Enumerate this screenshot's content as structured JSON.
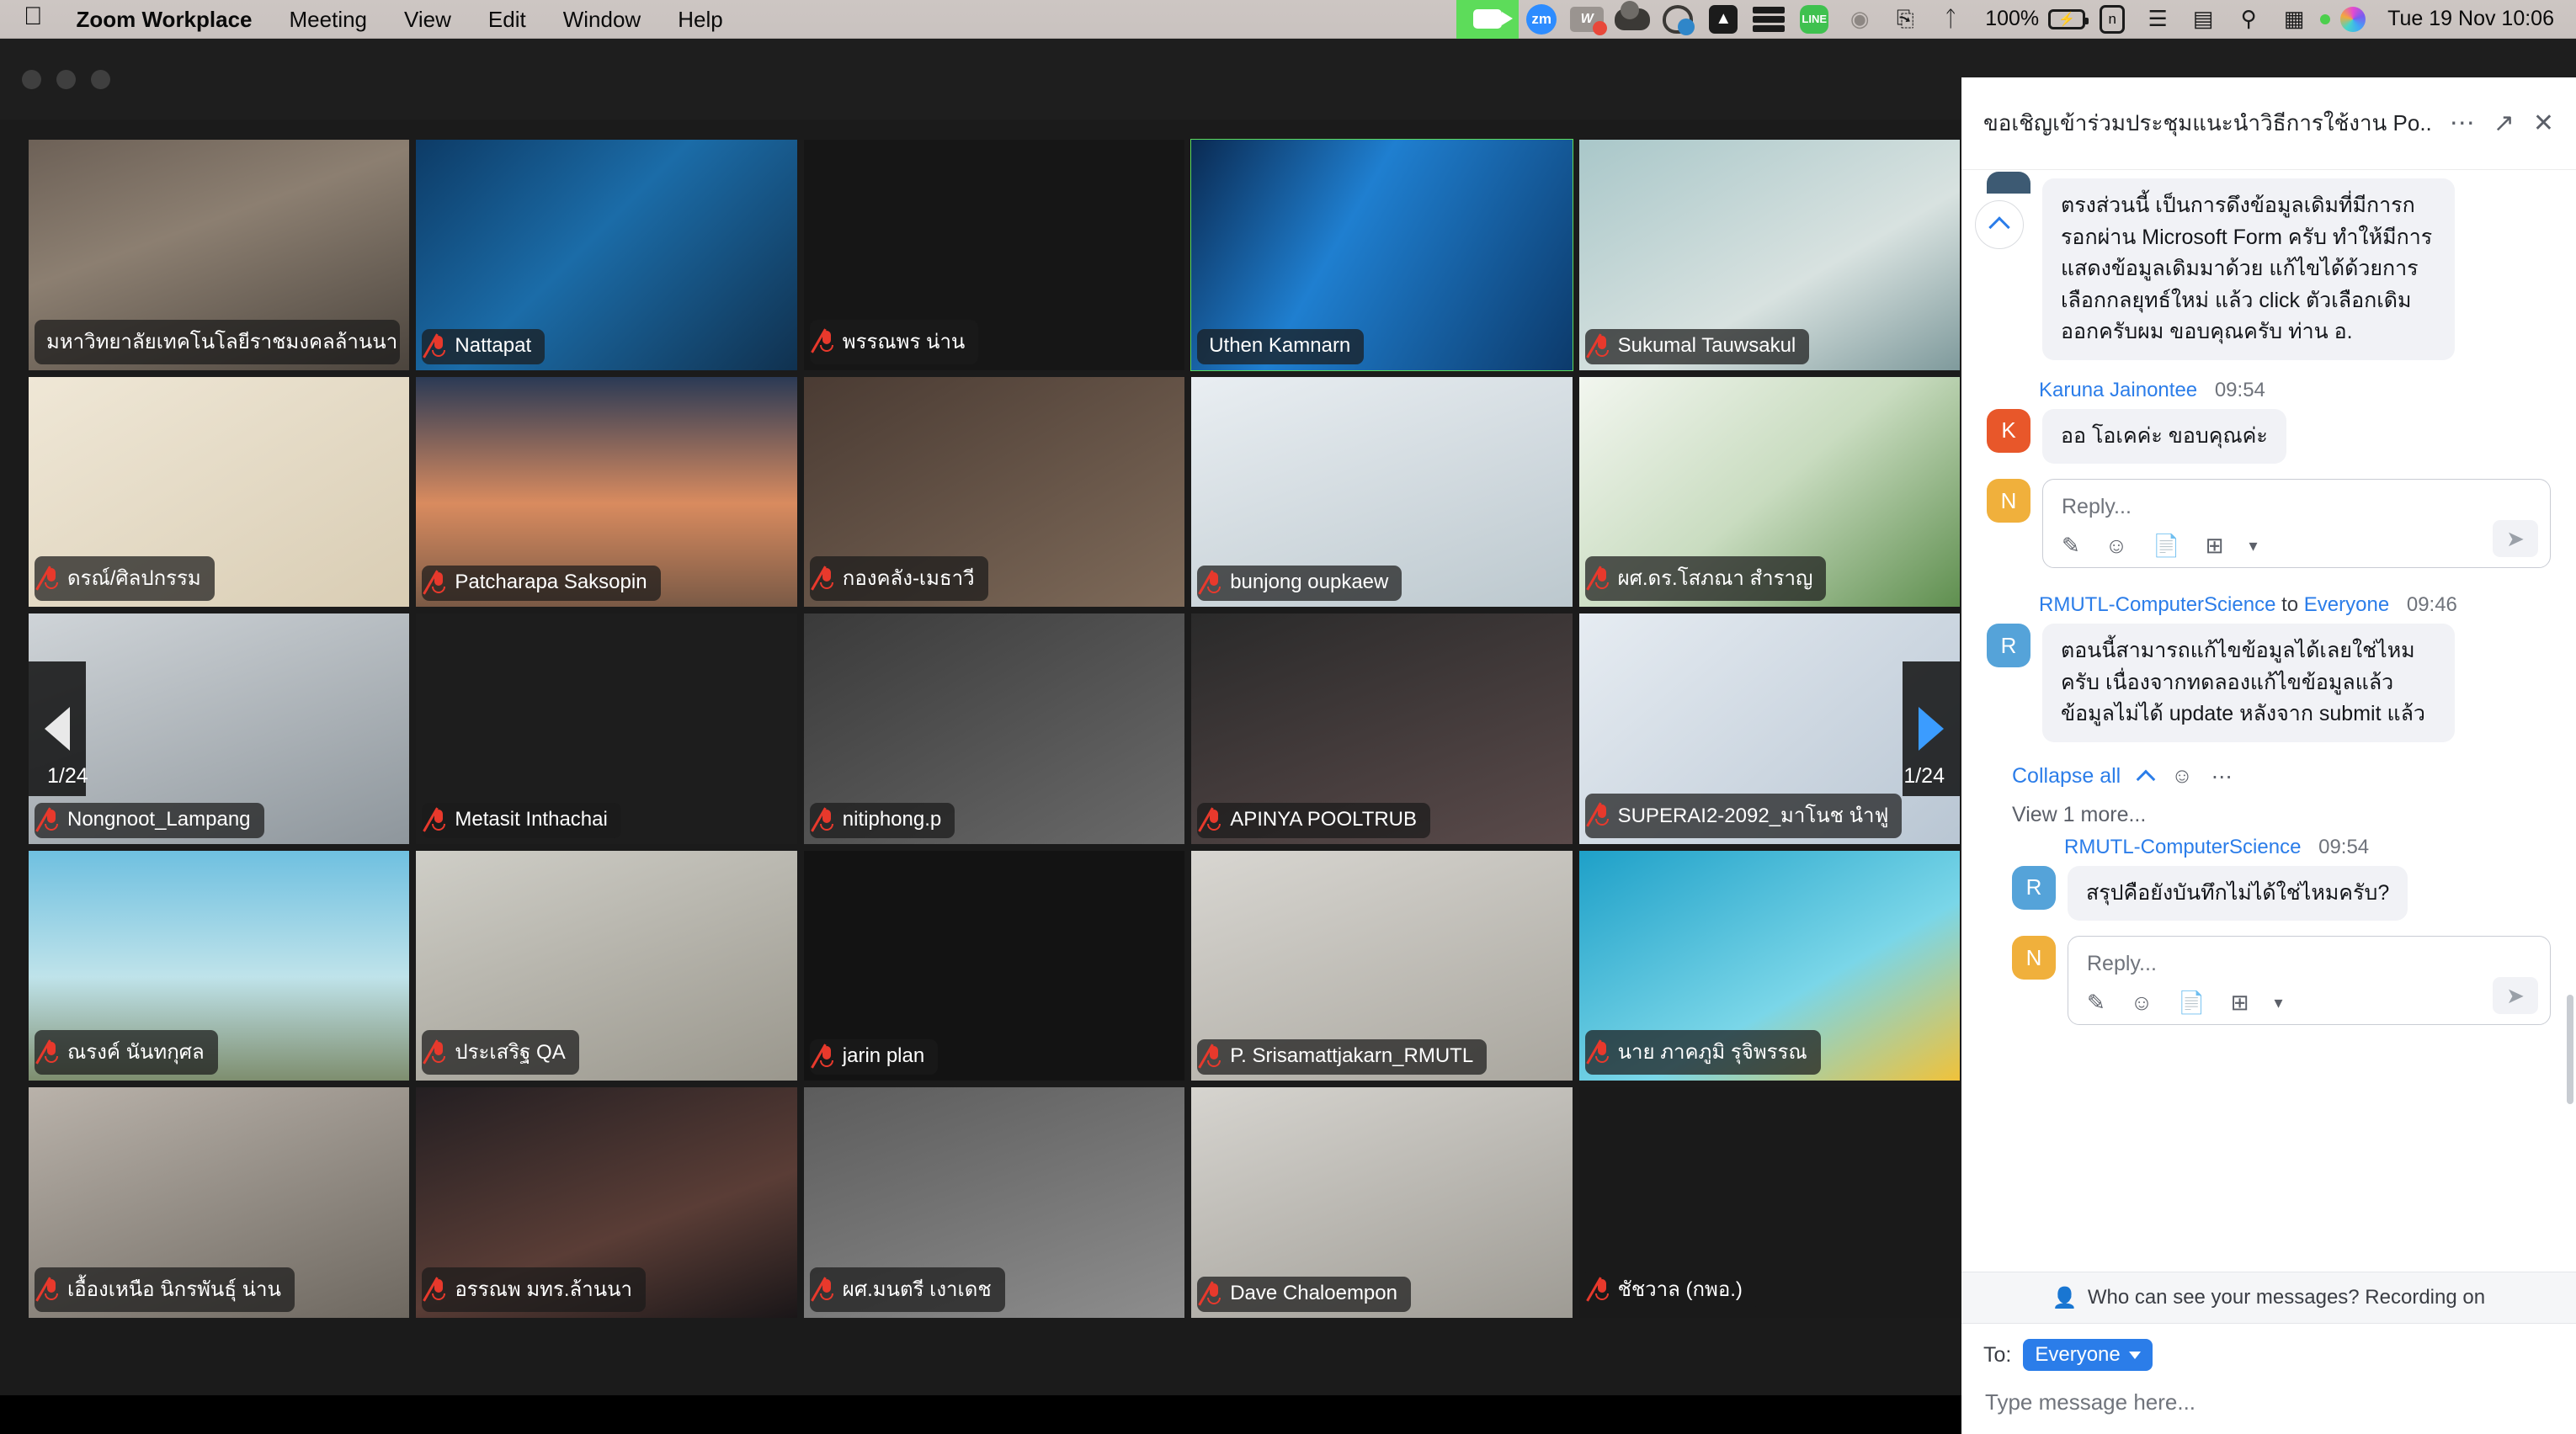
{
  "menubar": {
    "apple_logo": "apple-logo",
    "items": [
      {
        "label": "Zoom Workplace",
        "bold": true
      },
      {
        "label": "Meeting",
        "bold": false
      },
      {
        "label": "View",
        "bold": false
      },
      {
        "label": "Edit",
        "bold": false
      },
      {
        "label": "Window",
        "bold": false
      },
      {
        "label": "Help",
        "bold": false
      }
    ],
    "status_icons": [
      "camera-active-icon",
      "zoom-menubar-icon",
      "wps-office-icon",
      "onedrive-icon",
      "weibo-icon",
      "adobe-icon",
      "stack-icon",
      "line-icon",
      "airplay-icon",
      "screen-mirroring-icon",
      "bluetooth-off-icon"
    ],
    "battery_percent": "100%",
    "n_badge": "n",
    "clock": "Tue 19 Nov  10:06"
  },
  "window": {
    "traffic_lights": [
      "close",
      "minimize",
      "zoom"
    ]
  },
  "gallery": {
    "page_indicator_left": "1/24",
    "page_indicator_right": "1/24",
    "prev_page_icon": "chevron-left-icon",
    "next_page_icon": "chevron-right-icon",
    "participants": [
      {
        "name": "มหาวิทยาลัยเทคโนโลยีราชมงคลล้านนา",
        "muted": false,
        "active": false,
        "bg": "room"
      },
      {
        "name": "Nattapat",
        "muted": true,
        "active": false,
        "bg": "tech-blue"
      },
      {
        "name": "พรรณพร  น่าน",
        "muted": true,
        "active": false,
        "bg": "dark"
      },
      {
        "name": "Uthen Kamnarn",
        "muted": false,
        "active": true,
        "bg": "blue-abstract"
      },
      {
        "name": "Sukumal Tauwsakul",
        "muted": true,
        "active": false,
        "bg": "teal-room"
      },
      {
        "name": "ดรณ์/ศิลปกรรม",
        "muted": true,
        "active": false,
        "bg": "cream-emblem"
      },
      {
        "name": "Patcharapa Saksopin",
        "muted": true,
        "active": false,
        "bg": "sunset"
      },
      {
        "name": "กองคลัง-เมธาวี",
        "muted": true,
        "active": false,
        "bg": "warm-room"
      },
      {
        "name": "bunjong oupkaew",
        "muted": true,
        "active": false,
        "bg": "sat-banner"
      },
      {
        "name": "ผศ.ดร.โสภณา สำราญ",
        "muted": true,
        "active": false,
        "bg": "sat-rmutl-green"
      },
      {
        "name": "Nongnoot_Lampang",
        "muted": true,
        "active": false,
        "bg": "person-glasses"
      },
      {
        "name": "Metasit Inthachai",
        "muted": true,
        "active": false,
        "bg": "dark-portrait"
      },
      {
        "name": "nitiphong.p",
        "muted": true,
        "active": false,
        "bg": "indoor"
      },
      {
        "name": "APINYA POOLTRUB",
        "muted": true,
        "active": false,
        "bg": "pink-shirt"
      },
      {
        "name": "SUPERAI2-2092_มาโนช นำฟู",
        "muted": true,
        "active": false,
        "bg": "blockchain"
      },
      {
        "name": "ณรงค์ นันทกุศล",
        "muted": true,
        "active": false,
        "bg": "beach"
      },
      {
        "name": "ประเสริฐ QA",
        "muted": true,
        "active": false,
        "bg": "office-wall"
      },
      {
        "name": "jarin plan",
        "muted": true,
        "active": false,
        "bg": "dark2"
      },
      {
        "name": "P. Srisamattjakarn_RMUTL",
        "muted": true,
        "active": false,
        "bg": "lab"
      },
      {
        "name": "นาย ภาคภูมิ รุจิพรรณ",
        "muted": true,
        "active": false,
        "bg": "bulb-poster"
      },
      {
        "name": "เอื้องเหนือ นิกรพันธุ์ น่าน",
        "muted": true,
        "active": false,
        "bg": "portrait-w"
      },
      {
        "name": "อรรณพ มทร.ล้านนา",
        "muted": true,
        "active": false,
        "bg": "night-city"
      },
      {
        "name": "ผศ.มนตรี เงาเดช",
        "muted": true,
        "active": false,
        "bg": "grey-room"
      },
      {
        "name": "Dave Chaloempon",
        "muted": true,
        "active": false,
        "bg": "white-room"
      },
      {
        "name": "ชัชวาล (กพอ.)",
        "muted": true,
        "active": false,
        "bg": "dark3"
      }
    ]
  },
  "chat": {
    "title": "ขอเชิญเข้าร่วมประชุมแนะนำวิธีการใช้งาน Po...",
    "more_icon": "ellipsis-icon",
    "popout_icon": "pop-out-icon",
    "close_icon": "close-icon",
    "messages": [
      {
        "type": "continued",
        "avatar_letter": "",
        "avatar_color": "#3d5a73",
        "text": "ตรงส่วนนี้ เป็นการดึงข้อมูลเดิมที่มีการกรอกผ่าน Microsoft Form ครับ ทำให้มีการแสดงข้อมูลเดิมมาด้วย แก้ไขได้ด้วยการ เลือกกลยุทธ์ใหม่ แล้ว click ตัวเลือกเดิมออกครับผม ขอบคุณครับ ท่าน อ."
      },
      {
        "type": "message",
        "sender": "Karuna Jainontee",
        "to": "",
        "time": "09:54",
        "avatar_letter": "K",
        "avatar_color": "#e8572a",
        "text": "ออ โอเคค่ะ ขอบคุณค่ะ"
      }
    ],
    "reply_boxes": [
      {
        "avatar_letter": "N",
        "avatar_color": "#f0b03c",
        "placeholder": "Reply..."
      },
      {
        "avatar_letter": "N",
        "avatar_color": "#f0b03c",
        "placeholder": "Reply..."
      }
    ],
    "thread": {
      "sender": "RMUTL-ComputerScience",
      "to_label": "to",
      "to_target": "Everyone",
      "time": "09:46",
      "avatar_letter": "R",
      "avatar_color": "#55a3d9",
      "text": "ตอนนี้สามารถแก้ไขข้อมูลได้เลยใช่ไหมครับ เนื่องจากทดลองแก้ไขข้อมูลแล้วข้อมูลไม่ได้ update หลังจาก submit แล้ว",
      "collapse_all": "Collapse all",
      "collapse_chevron_icon": "chevron-up-icon",
      "emoji_icon": "add-reaction-icon",
      "more_icon": "ellipsis-icon",
      "view_more": "View 1 more...",
      "reply": {
        "sender": "RMUTL-ComputerScience",
        "time": "09:54",
        "avatar_letter": "R",
        "avatar_color": "#55a3d9",
        "text": "สรุปคือยังบันทึกไม่ได้ใช่ไหมครับ?"
      }
    },
    "reply_toolbar_icons": [
      "format-text-icon",
      "emoji-icon",
      "file-icon",
      "screenshot-icon",
      "chevron-down-icon"
    ],
    "send_icon": "send-icon",
    "notice": {
      "shield_icon": "privacy-shield-icon",
      "text": "Who can see your messages? Recording on"
    },
    "compose": {
      "to_label": "To:",
      "recipient": "Everyone",
      "recipient_caret_icon": "caret-down-icon",
      "placeholder": "Type message here..."
    }
  }
}
